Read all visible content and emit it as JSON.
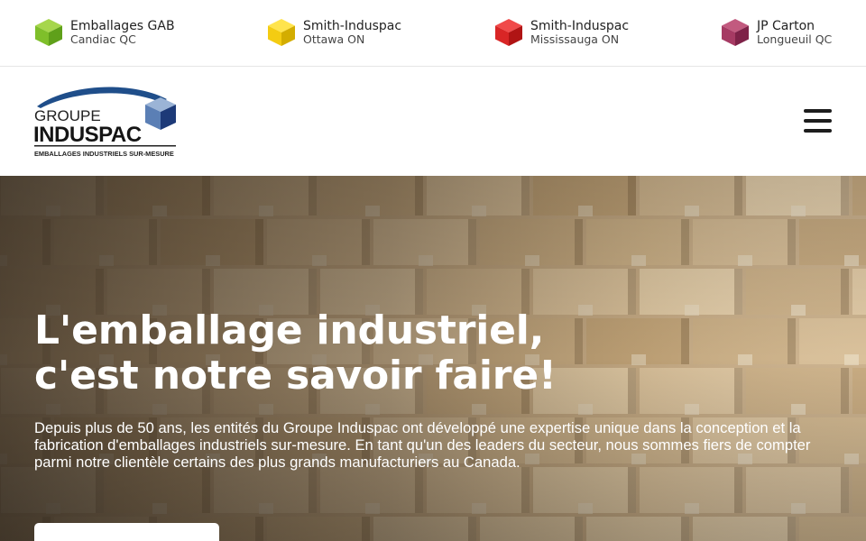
{
  "locations": [
    {
      "name": "Emballages GAB",
      "city": "Candiac QC",
      "color_top": "#a6d64c",
      "color_left": "#7fbf2a",
      "color_right": "#5fa01a"
    },
    {
      "name": "Smith-Induspac",
      "city": "Ottawa ON",
      "color_top": "#ffe44d",
      "color_left": "#f4cc12",
      "color_right": "#d3ad00"
    },
    {
      "name": "Smith-Induspac",
      "city": "Mississauga ON",
      "color_top": "#f04a4a",
      "color_left": "#d92626",
      "color_right": "#b01414"
    },
    {
      "name": "JP Carton",
      "city": "Longueuil QC",
      "color_top": "#c25a7f",
      "color_left": "#a63a63",
      "color_right": "#7e2248"
    }
  ],
  "logo": {
    "line1": "GROUPE",
    "line2": "INDUSPAC",
    "tagline": "EMBALLAGES INDUSTRIELS SUR-MESURE",
    "arc_color": "#1f4e8a",
    "cube_top": "#9bb4d6",
    "cube_left": "#5b7fb5",
    "cube_right": "#1d3a78"
  },
  "menu": {
    "icon": "hamburger-menu-icon"
  },
  "hero": {
    "title": "L'emballage industriel,\nc'est notre savoir faire!",
    "text": "Depuis plus de 50 ans, les entités du Groupe Induspac ont développé une expertise unique dans la conception et la fabrication d'emballages industriels sur-mesure. En tant qu'un des leaders du secteur, nous sommes fiers de compter parmi notre clientèle certains des plus grands manufacturiers au Canada.",
    "button_label": ""
  }
}
